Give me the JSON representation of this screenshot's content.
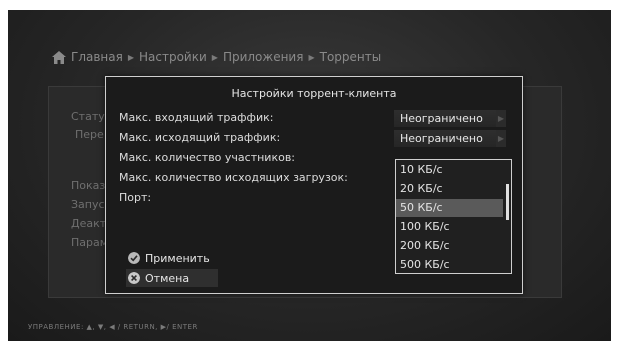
{
  "breadcrumb": [
    "Главная",
    "Настройки",
    "Приложения",
    "Торренты"
  ],
  "background_panel": {
    "items_top": [
      "Стату",
      "Пере"
    ],
    "items_list": [
      "Показ",
      "Запус",
      "Деакт",
      "Парам"
    ]
  },
  "dialog": {
    "title": "Настройки торрент-клиента",
    "rows": [
      {
        "label": "Макс. входящий траффик:",
        "value": "Неограничено"
      },
      {
        "label": "Макс. исходящий траффик:",
        "value": "Неограничено"
      },
      {
        "label": "Макс. количество участников:"
      },
      {
        "label": "Макс. количество исходящих загрузок:"
      },
      {
        "label": "Порт:"
      }
    ],
    "dropdown_options": [
      "10 КБ/с",
      "20 КБ/с",
      "50 КБ/с",
      "100 КБ/с",
      "200 КБ/с",
      "500 КБ/с"
    ],
    "selected_option": "50 КБ/с",
    "apply_button": "Применить",
    "cancel_button": "Отмена"
  },
  "footer": "УПРАВЛЕНИЕ:  ▲, ▼, ◀ / RETURN, ▶/ ENTER",
  "colors": {
    "background": "#262626",
    "dialog": "#1b1b1b",
    "border": "#cfcfcf",
    "selected": "#5a5a5a",
    "apply_icon": "#b8b8b8",
    "cancel_icon": "#c8c8c8"
  }
}
